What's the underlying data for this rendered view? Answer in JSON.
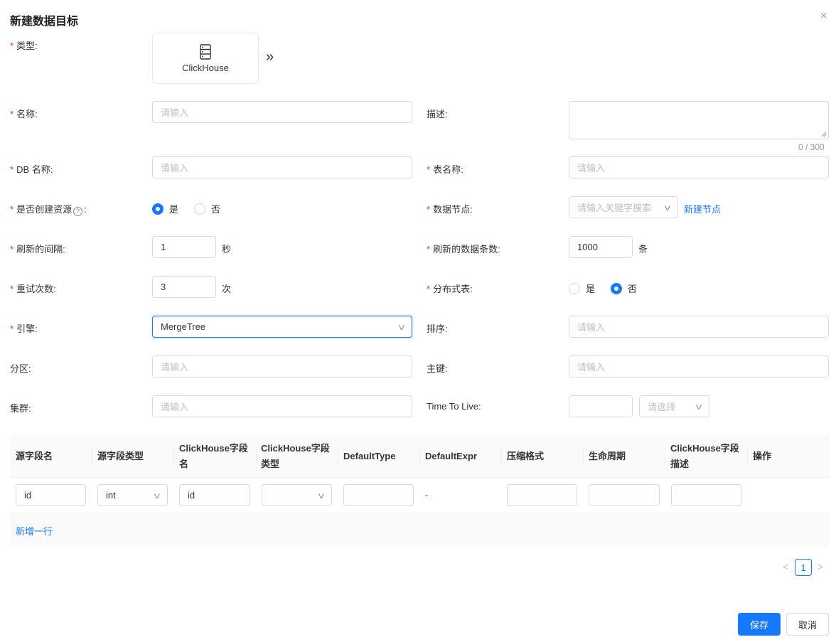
{
  "dialog": {
    "title": "新建数据目标",
    "close_icon": "×"
  },
  "form": {
    "type": {
      "label": "类型:",
      "card_name": "ClickHouse",
      "icon": "server-icon",
      "arrow": "»"
    },
    "name": {
      "label": "名称:",
      "placeholder": "请输入"
    },
    "description": {
      "label": "描述:",
      "count": "0 / 300"
    },
    "db_name": {
      "label": "DB 名称:",
      "placeholder": "请输入"
    },
    "table_name": {
      "label": "表名称:",
      "placeholder": "请输入"
    },
    "create_resource": {
      "label_before": "是否创建资源",
      "label_after": ":",
      "options": [
        "是",
        "否"
      ],
      "selected": "是"
    },
    "data_node": {
      "label": "数据节点:",
      "placeholder": "请输入关键字搜索",
      "link": "新建节点"
    },
    "flush_interval": {
      "label": "刷新的间隔:",
      "value": "1",
      "unit": "秒"
    },
    "flush_count": {
      "label": "刷新的数据条数:",
      "value": "1000",
      "unit": "条"
    },
    "retry_times": {
      "label": "重试次数:",
      "value": "3",
      "unit": "次"
    },
    "distributed": {
      "label": "分布式表:",
      "options": [
        "是",
        "否"
      ],
      "selected": "否"
    },
    "engine": {
      "label": "引擎:",
      "value": "MergeTree"
    },
    "order_by": {
      "label": "排序:",
      "placeholder": "请输入"
    },
    "partition": {
      "label": "分区:",
      "placeholder": "请输入"
    },
    "primary_key": {
      "label": "主键:",
      "placeholder": "请输入"
    },
    "cluster": {
      "label": "集群:",
      "placeholder": "请输入"
    },
    "ttl": {
      "label": "Time To Live:",
      "unit_placeholder": "请选择"
    }
  },
  "table": {
    "headers": [
      "源字段名",
      "源字段类型",
      "ClickHouse字段名",
      "ClickHouse字段类型",
      "DefaultType",
      "DefaultExpr",
      "压缩格式",
      "生命周期",
      "ClickHouse字段描述",
      "操作"
    ],
    "headers_wrapped": [
      [
        "源字段名"
      ],
      [
        "源字段类型"
      ],
      [
        "ClickHouse字段",
        "名"
      ],
      [
        "ClickHouse字段",
        "类型"
      ],
      [
        "DefaultType"
      ],
      [
        "DefaultExpr"
      ],
      [
        "压缩格式"
      ],
      [
        "生命周期"
      ],
      [
        "ClickHouse字段",
        "描述"
      ],
      [
        "操作"
      ]
    ],
    "rows": [
      {
        "source_field": "id",
        "source_type": "int",
        "ck_field": "id",
        "ck_type": "",
        "default_type": "",
        "default_expr": "-",
        "compression": "",
        "lifecycle": "",
        "ck_desc": ""
      }
    ],
    "add_row": "新增一行"
  },
  "pagination": {
    "prev": "<",
    "current": "1",
    "next": ">"
  },
  "footer": {
    "save": "保存",
    "cancel": "取消"
  },
  "colors": {
    "primary": "#1677ff",
    "required": "#e53935"
  }
}
